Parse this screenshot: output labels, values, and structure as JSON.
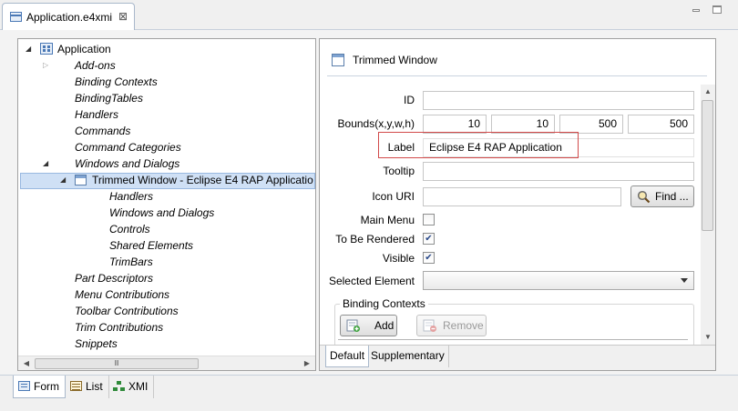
{
  "editor_tab": {
    "title": "Application.e4xmi",
    "close": "⊠"
  },
  "tree": {
    "root": "Application",
    "items": [
      {
        "label": "Add-ons"
      },
      {
        "label": "Binding Contexts"
      },
      {
        "label": "BindingTables"
      },
      {
        "label": "Handlers"
      },
      {
        "label": "Commands"
      },
      {
        "label": "Command Categories"
      },
      {
        "label": "Windows and Dialogs"
      },
      {
        "label": "Trimmed Window - Eclipse E4 RAP Applicatio"
      },
      {
        "label": "Handlers"
      },
      {
        "label": "Windows and Dialogs"
      },
      {
        "label": "Controls"
      },
      {
        "label": "Shared Elements"
      },
      {
        "label": "TrimBars"
      },
      {
        "label": "Part Descriptors"
      },
      {
        "label": "Menu Contributions"
      },
      {
        "label": "Toolbar Contributions"
      },
      {
        "label": "Trim Contributions"
      },
      {
        "label": "Snippets"
      }
    ],
    "hscroll_thumb": "Ⅲ"
  },
  "detail": {
    "title": "Trimmed Window",
    "labels": {
      "id": "ID",
      "bounds": "Bounds(x,y,w,h)",
      "label": "Label",
      "tooltip": "Tooltip",
      "icon_uri": "Icon URI",
      "main_menu": "Main Menu",
      "to_be_rendered": "To Be Rendered",
      "visible": "Visible",
      "selected_element": "Selected Element"
    },
    "values": {
      "id": "",
      "bounds_x": "10",
      "bounds_y": "10",
      "bounds_w": "500",
      "bounds_h": "500",
      "label": "Eclipse E4 RAP Application",
      "tooltip": "",
      "icon_uri": "",
      "selected_element": ""
    },
    "checks": {
      "main_menu": false,
      "to_be_rendered": true,
      "visible": true
    },
    "find_button": "Find ...",
    "binding_contexts": {
      "legend": "Binding Contexts",
      "add_button": "Add",
      "remove_button": "Remove"
    },
    "tabs": [
      "Default",
      "Supplementary"
    ]
  },
  "bottom_tabs": [
    "Form",
    "List",
    "XMI"
  ],
  "colors": {
    "highlight": "#d24a4a",
    "selection": "#cfe0f5"
  }
}
